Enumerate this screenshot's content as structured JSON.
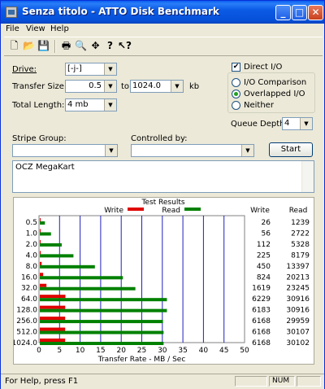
{
  "window": {
    "title": "Senza titolo - ATTO Disk Benchmark",
    "minimize": "_",
    "maximize": "□",
    "close": "✕"
  },
  "menu": [
    "File",
    "View",
    "Help"
  ],
  "toolbar": {
    "icons": [
      "new-icon",
      "open-icon",
      "save-icon",
      "print-icon",
      "print-preview-icon",
      "move-icon",
      "help-icon",
      "context-help-icon"
    ]
  },
  "form": {
    "drive_label": "Drive:",
    "drive_value": "[-j-]",
    "transfer_size_label": "Transfer Size:",
    "transfer_from": "0.5",
    "to_label": "to",
    "transfer_to": "1024.0",
    "kb_label": "kb",
    "total_length_label": "Total Length:",
    "total_length_value": "4 mb",
    "direct_io_label": "Direct I/O",
    "direct_io_checked": true,
    "io_comparison_label": "I/O Comparison",
    "overlapped_io_label": "Overlapped I/O",
    "neither_label": "Neither",
    "selected_mode": "Overlapped I/O",
    "queue_depth_label": "Queue Depth:",
    "queue_depth_value": "4",
    "stripe_group_label": "Stripe Group:",
    "stripe_group_value": "",
    "controlled_by_label": "Controlled by:",
    "controlled_by_value": "",
    "start_button": "Start",
    "description": "OCZ MegaKart"
  },
  "results": {
    "group_title": "Test Results",
    "legend_write": "Write",
    "legend_read": "Read",
    "col_write": "Write",
    "col_read": "Read",
    "write_color": "#e00000",
    "read_color": "#008000"
  },
  "chart_data": {
    "type": "bar",
    "orientation": "horizontal",
    "categories": [
      "0.5",
      "1.0",
      "2.0",
      "4.0",
      "8.0",
      "16.0",
      "32.0",
      "64.0",
      "128.0",
      "256.0",
      "512.0",
      "1024.0"
    ],
    "series": [
      {
        "name": "Write",
        "values": [
          0.026,
          0.056,
          0.112,
          0.225,
          0.45,
          0.824,
          1.619,
          6.229,
          6.183,
          6.168,
          6.168,
          6.168
        ]
      },
      {
        "name": "Read",
        "values": [
          1.239,
          2.722,
          5.328,
          8.179,
          13.397,
          20.213,
          23.245,
          30.916,
          30.916,
          29.959,
          30.107,
          30.102
        ]
      }
    ],
    "write_kbps": [
      "26",
      "56",
      "112",
      "225",
      "450",
      "824",
      "1619",
      "6229",
      "6183",
      "6168",
      "6168",
      "6168"
    ],
    "read_kbps": [
      "1239",
      "2722",
      "5328",
      "8179",
      "13397",
      "20213",
      "23245",
      "30916",
      "30916",
      "29959",
      "30107",
      "30102"
    ],
    "xlabel": "Transfer Rate - MB / Sec",
    "xticks": [
      "0",
      "5",
      "10",
      "15",
      "20",
      "25",
      "30",
      "35",
      "40",
      "45",
      "50"
    ],
    "xlim": [
      0,
      50
    ],
    "grid": true,
    "legend": "top-center"
  },
  "status": {
    "help_text": "For Help, press F1",
    "num": "NUM"
  }
}
